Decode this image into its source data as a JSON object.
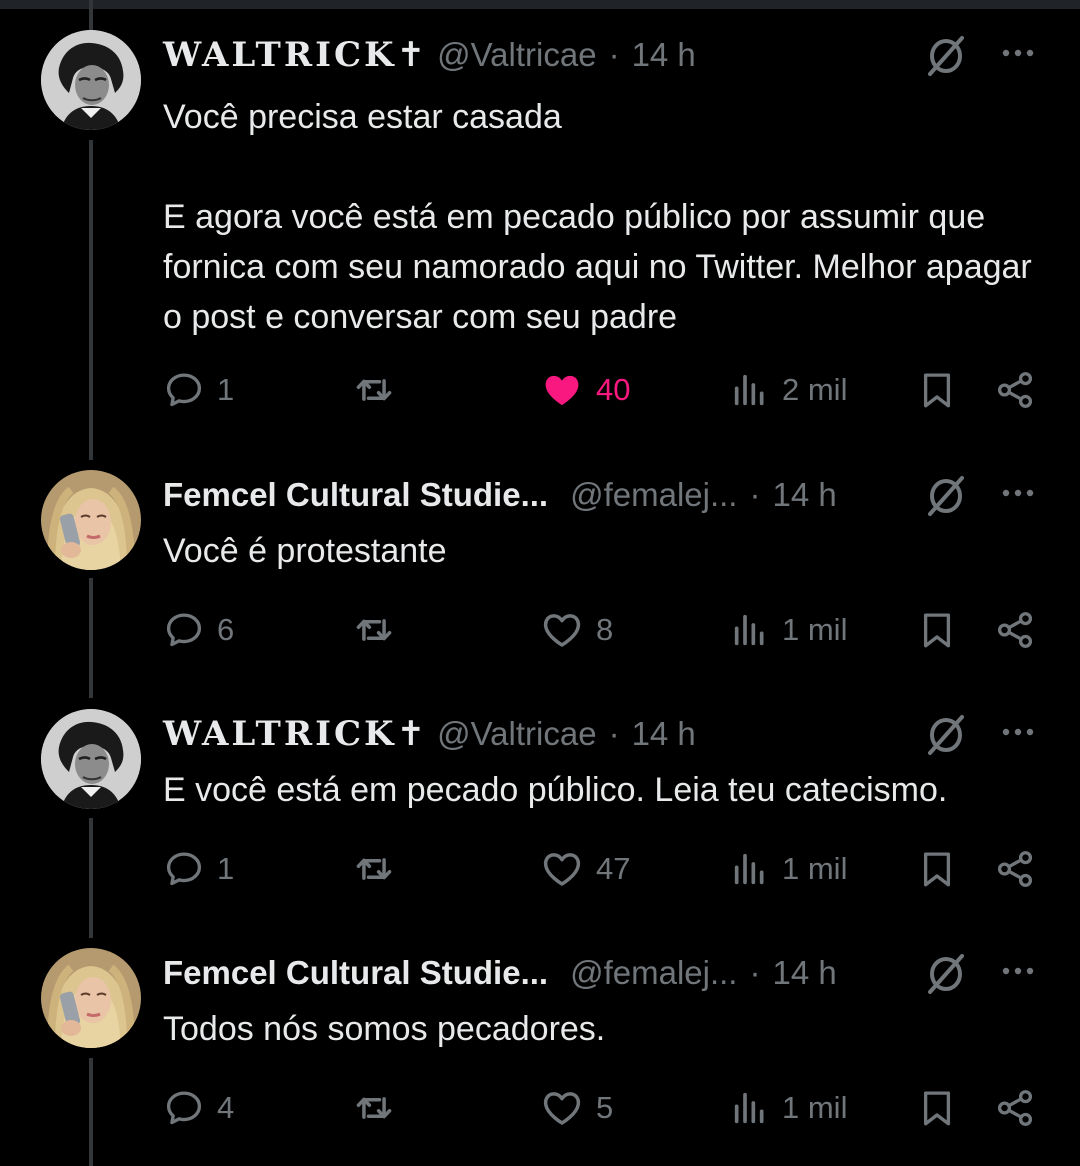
{
  "tweets": [
    {
      "author": {
        "name": "WALTRICK",
        "name_symbol": "✝",
        "handle": "@Valtricae",
        "avatar": "beethoven-portrait-avatar"
      },
      "separator": "·",
      "time": "14 h",
      "text": [
        "Você precisa estar casada",
        "E agora você está em pecado público por assumir que fornica com seu namorado aqui no Twitter. Melhor apagar o post e conversar com seu padre"
      ],
      "stats": {
        "replies": "1",
        "retweets": "",
        "likes": "40",
        "liked": true,
        "views": "2 mil"
      }
    },
    {
      "author": {
        "name": "Femcel Cultural Studie...",
        "handle": "@femalej...",
        "avatar": "blonde-woman-phone-avatar"
      },
      "separator": "·",
      "time": "14 h",
      "text": [
        "Você é protestante"
      ],
      "stats": {
        "replies": "6",
        "retweets": "",
        "likes": "8",
        "liked": false,
        "views": "1 mil"
      }
    },
    {
      "author": {
        "name": "WALTRICK",
        "name_symbol": "✝",
        "handle": "@Valtricae",
        "avatar": "beethoven-portrait-avatar"
      },
      "separator": "·",
      "time": "14 h",
      "text": [
        "E você está em pecado público. Leia teu catecismo."
      ],
      "stats": {
        "replies": "1",
        "retweets": "",
        "likes": "47",
        "liked": false,
        "views": "1 mil"
      }
    },
    {
      "author": {
        "name": "Femcel Cultural Studie...",
        "handle": "@femalej...",
        "avatar": "blonde-woman-phone-avatar"
      },
      "separator": "·",
      "time": "14 h",
      "text": [
        "Todos nós somos pecadores."
      ],
      "stats": {
        "replies": "4",
        "retweets": "",
        "likes": "5",
        "liked": false,
        "views": "1 mil"
      }
    }
  ],
  "icons": {
    "reply": "reply-icon",
    "retweet": "retweet-icon",
    "like": "heart-icon",
    "views": "views-chart-icon",
    "bookmark": "bookmark-icon",
    "share": "share-icon",
    "mute": "muted-conversation-icon",
    "more": "more-options-icon"
  },
  "colors": {
    "background": "#000000",
    "text_primary": "#e7e9ea",
    "text_secondary": "#71767b",
    "like_active": "#f91880",
    "thread_line": "#333639"
  }
}
